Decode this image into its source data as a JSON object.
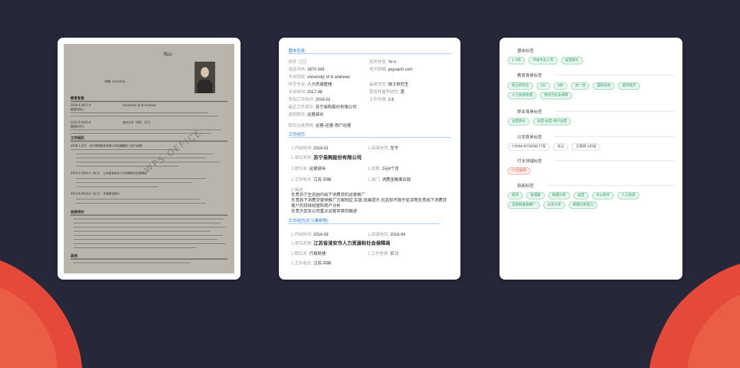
{
  "colors": {
    "background": "#262739",
    "wave": "#e5493a",
    "accent_blue": "#2a7ad6",
    "tag_green": "#2f9c63",
    "tag_red": "#e05a4a"
  },
  "scan": {
    "signature": "陆山",
    "contact": "邮箱: yeyuan@...",
    "edu_title": "教育背景",
    "edu1_school": "University of St Andrews",
    "edu1_year": "2016.9-2017.9",
    "edu1_major": "管理学硕士",
    "edu2_year": "2012.9-2016.6",
    "edu2_school": "南京大学（985、211）",
    "edu2_major": "管理学学士",
    "work_title": "工作经历",
    "work1": "2018.1-至今　苏宁易购股份有限公司金融集团（苏宁金融）",
    "work2": "2015.2-2016.4（实习）　江苏省淮安市人力资源和社会保障局",
    "work3": "2014.6-2014.8（实习）　中国建设银行",
    "self_title": "自我评价",
    "other_title": "其他",
    "watermark": "WPS OFFICE"
  },
  "parsed": {
    "basic_title": "基本信息",
    "name_k": "姓名:",
    "name_en_k": "姓名拼音:",
    "name_en_v": "Ye      n",
    "phone_k": "电话号码:",
    "phone_v": "1870      343",
    "email_k": "电子邮箱:",
    "email_v": "yeyuan0      com",
    "school_k": "毕业院校:",
    "school_v": "university of st andrews",
    "major_k": "所学专业:",
    "major_v": "人力资源管理",
    "degree_k": "最高学历:",
    "degree_v": "硕士研究生",
    "grad_k": "毕业时间:",
    "grad_v": "2017-08",
    "overseas_k": "是否有留学经历:",
    "overseas_v": "是",
    "workstart_k": "参加工作时间:",
    "workstart_v": "2018-01",
    "years_k": "工作年限:",
    "years_v": "2.6",
    "lastco_k": "最近工作单位:",
    "lastco_v": "苏宁易购股份有限公司",
    "lastpos_k": "现职职位:",
    "lastpos_v": "运营部长",
    "cls_k": "职位分类预测:",
    "cls_v": "运营-运营-用户运营",
    "work_title": "工作经历",
    "w_start_k": "1.开始时间:",
    "w_start_v": "2018-01",
    "w_end_k": "1.结束时间:",
    "w_end_v": "至今",
    "w_co_k": "1.单位名称:",
    "w_co_v": "苏宁易购股份有限公司",
    "w_pos_k": "1.职位名:",
    "w_pos_v": "运营部长",
    "w_sal_k": "1.月薪:",
    "w_sal_v": "2元6个月",
    "w_loc_k": "1.工作地点:",
    "w_loc_v": "江苏,中国",
    "w_dept_k": "1.部门:",
    "w_dept_v": "消费金融事业部",
    "w_desc_k": "1.描述:",
    "w_desc1": "负责苏宁生态圈内线下消费贷的运营推广",
    "w_desc2": "负责线下消费贷营销推广方案制定,实施,效果提升,包括但不限于促活等负责线下消费贷",
    "w_desc3": "客户的持续经营和用户分析",
    "w_desc4": "负责大促及公司重点运营项目的跟进",
    "intern_title": "工作经历(实习兼职等)",
    "i_start_k": "1.开始时间:",
    "i_start_v": "2016-03",
    "i_end_k": "1.结束时间:",
    "i_end_v": "2016-04",
    "i_co_k": "1.单位名称:",
    "i_co_v": "江苏省淮安市人力资源和社会保障局",
    "i_pos_k": "1.职位名:",
    "i_pos_v": "行政助理",
    "i_type_k": "1.工作性质:",
    "i_type_v": "实习",
    "i_loc_k": "1.工作地点:",
    "i_loc_v": "江苏,中国"
  },
  "tags": {
    "basic": {
      "title": "基本标签",
      "items": [
        "1~3年",
        "中级专业人员",
        "运营部长"
      ]
    },
    "edu": {
      "title": "教育背景标签",
      "items": [
        "硕士研究生",
        "211",
        "985",
        "双一流",
        "国际名校",
        "留学经历",
        "人力资源管理",
        "劳动与社会保障"
      ]
    },
    "career": {
      "title": "职业背景标签",
      "items": [
        "运营部长",
        "运营-运营-用户运营"
      ]
    },
    "company": {
      "title": "公司背景标签",
      "items": [
        "CHINA INTERNET7强",
        "名企",
        "互联网 100强"
      ]
    },
    "industry": {
      "title": "行业领域标签",
      "items": [
        "IT/互联网"
      ]
    },
    "skill": {
      "title": "技能标签",
      "items": [
        "经济",
        "管理策",
        "数据分析",
        "运营",
        "办公软件",
        "人力资源",
        "互联网金融推广",
        "业务分析",
        "数据分析能力"
      ]
    }
  }
}
